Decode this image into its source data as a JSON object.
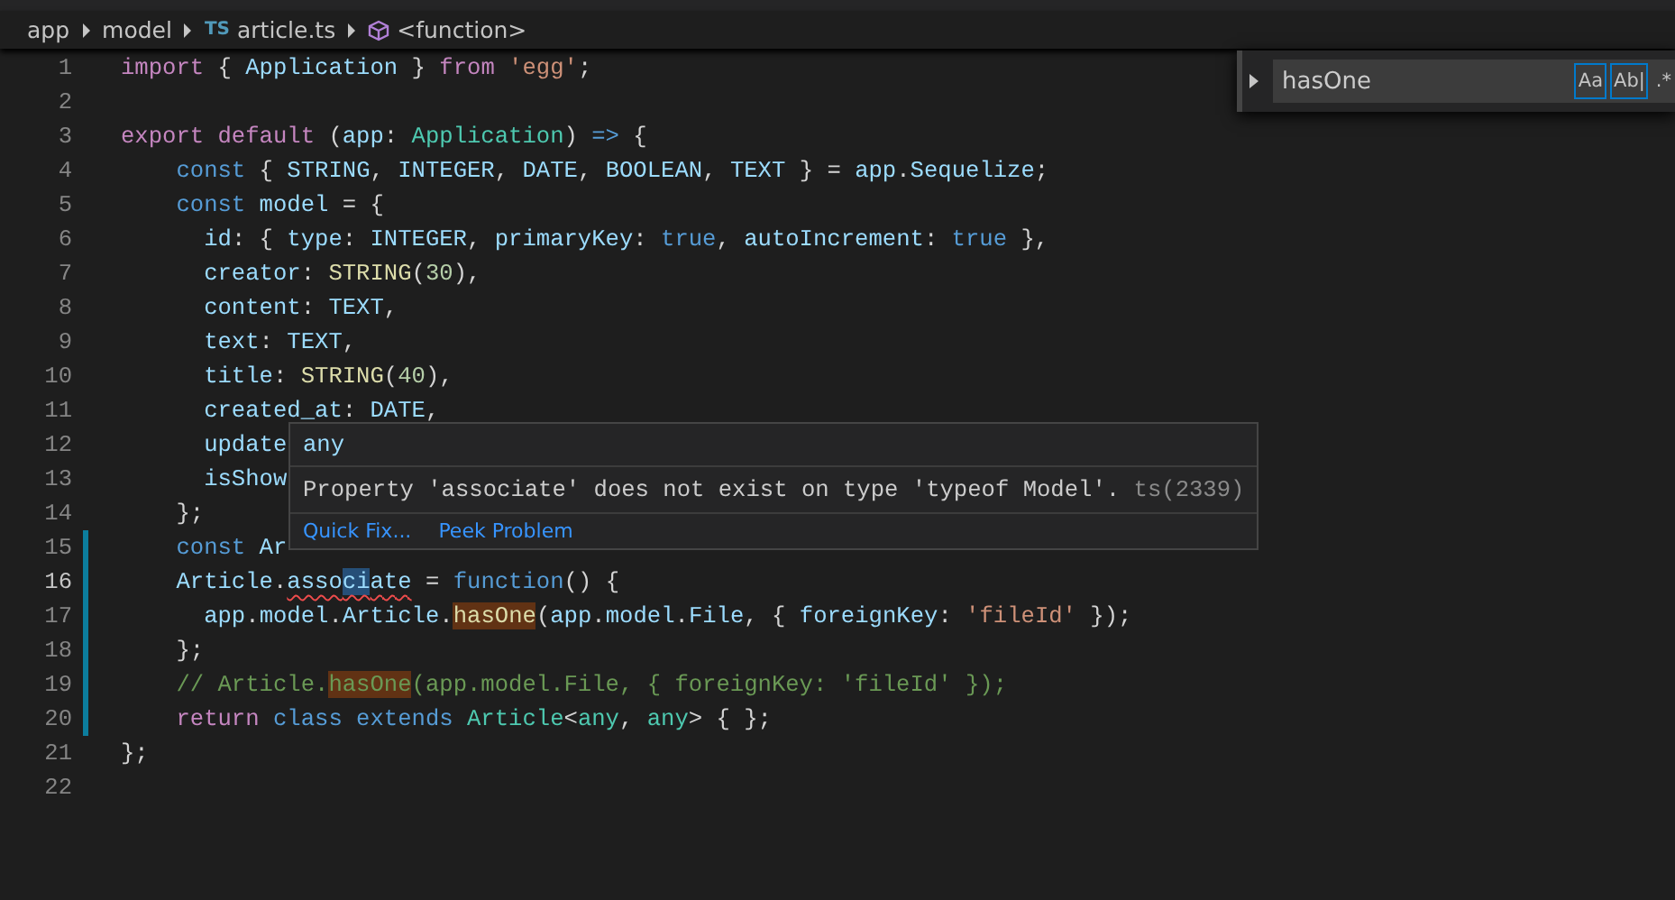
{
  "breadcrumbs": [
    {
      "label": "app",
      "kind": "folder"
    },
    {
      "label": "model",
      "kind": "folder"
    },
    {
      "label": "article.ts",
      "kind": "file",
      "badge": "TS"
    },
    {
      "label": "<function>",
      "kind": "symbol"
    }
  ],
  "lines": [
    {
      "number": "1",
      "current": false,
      "modified": false,
      "tokens": [
        {
          "text": "import",
          "kind": "kw"
        },
        {
          "text": " { ",
          "kind": "p"
        },
        {
          "text": "Application",
          "kind": "var"
        },
        {
          "text": " } ",
          "kind": "p"
        },
        {
          "text": "from",
          "kind": "kw"
        },
        {
          "text": " 'egg'",
          "kind": "str"
        },
        {
          "text": ";",
          "kind": "p"
        }
      ]
    },
    {
      "number": "2",
      "current": false,
      "modified": false
    },
    {
      "number": "3",
      "current": false,
      "modified": false,
      "tokens": [
        {
          "text": "export",
          "kind": "kw"
        },
        {
          "text": " default",
          "kind": "kw"
        },
        {
          "text": " (",
          "kind": "p"
        },
        {
          "text": "app",
          "kind": "var"
        },
        {
          "text": ": ",
          "kind": "p"
        },
        {
          "text": "Application",
          "kind": "type"
        },
        {
          "text": ") ",
          "kind": "p"
        },
        {
          "text": "=>",
          "kind": "st"
        },
        {
          "text": " {",
          "kind": "p"
        }
      ]
    },
    {
      "number": "4",
      "current": false,
      "modified": false,
      "tokens": [
        {
          "text": "    const",
          "kind": "st"
        },
        {
          "text": " { ",
          "kind": "p"
        },
        {
          "text": "STRING",
          "kind": "var"
        },
        {
          "text": ", ",
          "kind": "p"
        },
        {
          "text": "INTEGER",
          "kind": "var"
        },
        {
          "text": ", ",
          "kind": "p"
        },
        {
          "text": "DATE",
          "kind": "var"
        },
        {
          "text": ", ",
          "kind": "p"
        },
        {
          "text": "BOOLEAN",
          "kind": "var"
        },
        {
          "text": ", ",
          "kind": "p"
        },
        {
          "text": "TEXT",
          "kind": "var"
        },
        {
          "text": " } = ",
          "kind": "p"
        },
        {
          "text": "app",
          "kind": "var"
        },
        {
          "text": ".",
          "kind": "p"
        },
        {
          "text": "Sequelize",
          "kind": "var"
        },
        {
          "text": ";",
          "kind": "p"
        }
      ]
    },
    {
      "number": "5",
      "current": false,
      "modified": false,
      "tokens": [
        {
          "text": "    const",
          "kind": "st"
        },
        {
          "text": " model",
          "kind": "var"
        },
        {
          "text": " = {",
          "kind": "p"
        }
      ]
    },
    {
      "number": "6",
      "current": false,
      "modified": false,
      "tokens": [
        {
          "text": "      id",
          "kind": "var"
        },
        {
          "text": ": { ",
          "kind": "p"
        },
        {
          "text": "type",
          "kind": "var"
        },
        {
          "text": ": ",
          "kind": "p"
        },
        {
          "text": "INTEGER",
          "kind": "var"
        },
        {
          "text": ", ",
          "kind": "p"
        },
        {
          "text": "primaryKey",
          "kind": "var"
        },
        {
          "text": ": ",
          "kind": "p"
        },
        {
          "text": "true",
          "kind": "st"
        },
        {
          "text": ", ",
          "kind": "p"
        },
        {
          "text": "autoIncrement",
          "kind": "var"
        },
        {
          "text": ": ",
          "kind": "p"
        },
        {
          "text": "true",
          "kind": "st"
        },
        {
          "text": " },",
          "kind": "p"
        }
      ]
    },
    {
      "number": "7",
      "current": false,
      "modified": false,
      "tokens": [
        {
          "text": "      creator",
          "kind": "var"
        },
        {
          "text": ": ",
          "kind": "p"
        },
        {
          "text": "STRING",
          "kind": "fn"
        },
        {
          "text": "(",
          "kind": "p"
        },
        {
          "text": "30",
          "kind": "num"
        },
        {
          "text": "),",
          "kind": "p"
        }
      ]
    },
    {
      "number": "8",
      "current": false,
      "modified": false,
      "tokens": [
        {
          "text": "      content",
          "kind": "var"
        },
        {
          "text": ": ",
          "kind": "p"
        },
        {
          "text": "TEXT",
          "kind": "var"
        },
        {
          "text": ",",
          "kind": "p"
        }
      ]
    },
    {
      "number": "9",
      "current": false,
      "modified": false,
      "tokens": [
        {
          "text": "      text",
          "kind": "var"
        },
        {
          "text": ": ",
          "kind": "p"
        },
        {
          "text": "TEXT",
          "kind": "var"
        },
        {
          "text": ",",
          "kind": "p"
        }
      ]
    },
    {
      "number": "10",
      "current": false,
      "modified": false,
      "tokens": [
        {
          "text": "      title",
          "kind": "var"
        },
        {
          "text": ": ",
          "kind": "p"
        },
        {
          "text": "STRING",
          "kind": "fn"
        },
        {
          "text": "(",
          "kind": "p"
        },
        {
          "text": "40",
          "kind": "num"
        },
        {
          "text": "),",
          "kind": "p"
        }
      ]
    },
    {
      "number": "11",
      "current": false,
      "modified": false,
      "tokens": [
        {
          "text": "      created_at",
          "kind": "var"
        },
        {
          "text": ": ",
          "kind": "p"
        },
        {
          "text": "DATE",
          "kind": "var"
        },
        {
          "text": ",",
          "kind": "p"
        }
      ]
    },
    {
      "number": "12",
      "current": false,
      "modified": false,
      "tokens": [
        {
          "text": "      update",
          "kind": "var"
        }
      ]
    },
    {
      "number": "13",
      "current": false,
      "modified": false,
      "tokens": [
        {
          "text": "      isShow",
          "kind": "var"
        }
      ]
    },
    {
      "number": "14",
      "current": false,
      "modified": false,
      "tokens": [
        {
          "text": "    };",
          "kind": "p"
        }
      ]
    },
    {
      "number": "15",
      "current": false,
      "modified": true,
      "tokens": [
        {
          "text": "    const",
          "kind": "st"
        },
        {
          "text": " Ar",
          "kind": "var"
        }
      ]
    },
    {
      "number": "16",
      "current": true,
      "modified": true,
      "tokens": [
        {
          "text": "    Article",
          "kind": "var"
        },
        {
          "text": ".",
          "kind": "p"
        },
        {
          "text": "asso",
          "kind": "error"
        },
        {
          "text": "ci",
          "kind": "errorcursor"
        },
        {
          "text": "ate",
          "kind": "error"
        },
        {
          "text": " = ",
          "kind": "p"
        },
        {
          "text": "function",
          "kind": "st"
        },
        {
          "text": "() {",
          "kind": "p"
        }
      ]
    },
    {
      "number": "17",
      "current": false,
      "modified": true,
      "tokens": [
        {
          "text": "      app",
          "kind": "var"
        },
        {
          "text": ".",
          "kind": "p"
        },
        {
          "text": "model",
          "kind": "var"
        },
        {
          "text": ".",
          "kind": "p"
        },
        {
          "text": "Article",
          "kind": "var"
        },
        {
          "text": ".",
          "kind": "p"
        },
        {
          "text": "hasOne",
          "kind": "fnmatch"
        },
        {
          "text": "(",
          "kind": "p"
        },
        {
          "text": "app",
          "kind": "var"
        },
        {
          "text": ".",
          "kind": "p"
        },
        {
          "text": "model",
          "kind": "var"
        },
        {
          "text": ".",
          "kind": "p"
        },
        {
          "text": "File",
          "kind": "var"
        },
        {
          "text": ", { ",
          "kind": "p"
        },
        {
          "text": "foreignKey",
          "kind": "var"
        },
        {
          "text": ": ",
          "kind": "p"
        },
        {
          "text": "'fileId'",
          "kind": "str"
        },
        {
          "text": " });",
          "kind": "p"
        }
      ]
    },
    {
      "number": "18",
      "current": false,
      "modified": true,
      "tokens": [
        {
          "text": "    };",
          "kind": "p"
        }
      ]
    },
    {
      "number": "19",
      "current": false,
      "modified": true,
      "tokens": [
        {
          "text": "    // Article.",
          "kind": "cm"
        },
        {
          "text": "hasOne",
          "kind": "cmmatch"
        },
        {
          "text": "(app.model.File, { foreignKey: 'fileId' });",
          "kind": "cm"
        }
      ]
    },
    {
      "number": "20",
      "current": false,
      "modified": true,
      "tokens": [
        {
          "text": "    return",
          "kind": "kw"
        },
        {
          "text": " class",
          "kind": "st"
        },
        {
          "text": " extends",
          "kind": "st"
        },
        {
          "text": " Article",
          "kind": "type"
        },
        {
          "text": "<",
          "kind": "p"
        },
        {
          "text": "any",
          "kind": "type"
        },
        {
          "text": ", ",
          "kind": "p"
        },
        {
          "text": "any",
          "kind": "type"
        },
        {
          "text": "> { };",
          "kind": "p"
        }
      ]
    },
    {
      "number": "21",
      "current": false,
      "modified": false,
      "tokens": [
        {
          "text": "};",
          "kind": "p"
        }
      ]
    },
    {
      "number": "22",
      "current": false,
      "modified": false
    }
  ],
  "hover": {
    "type": "any",
    "message": "Property 'associate' does not exist on type 'typeof Model'.",
    "code": "ts(2339)",
    "actions": [
      "Quick Fix...",
      "Peek Problem"
    ]
  },
  "find": {
    "value": "hasOne",
    "options": [
      {
        "label": "Aa",
        "selected": true
      },
      {
        "label": "Ab|",
        "selected": true
      },
      {
        "label": ".*",
        "selected": false
      }
    ]
  }
}
